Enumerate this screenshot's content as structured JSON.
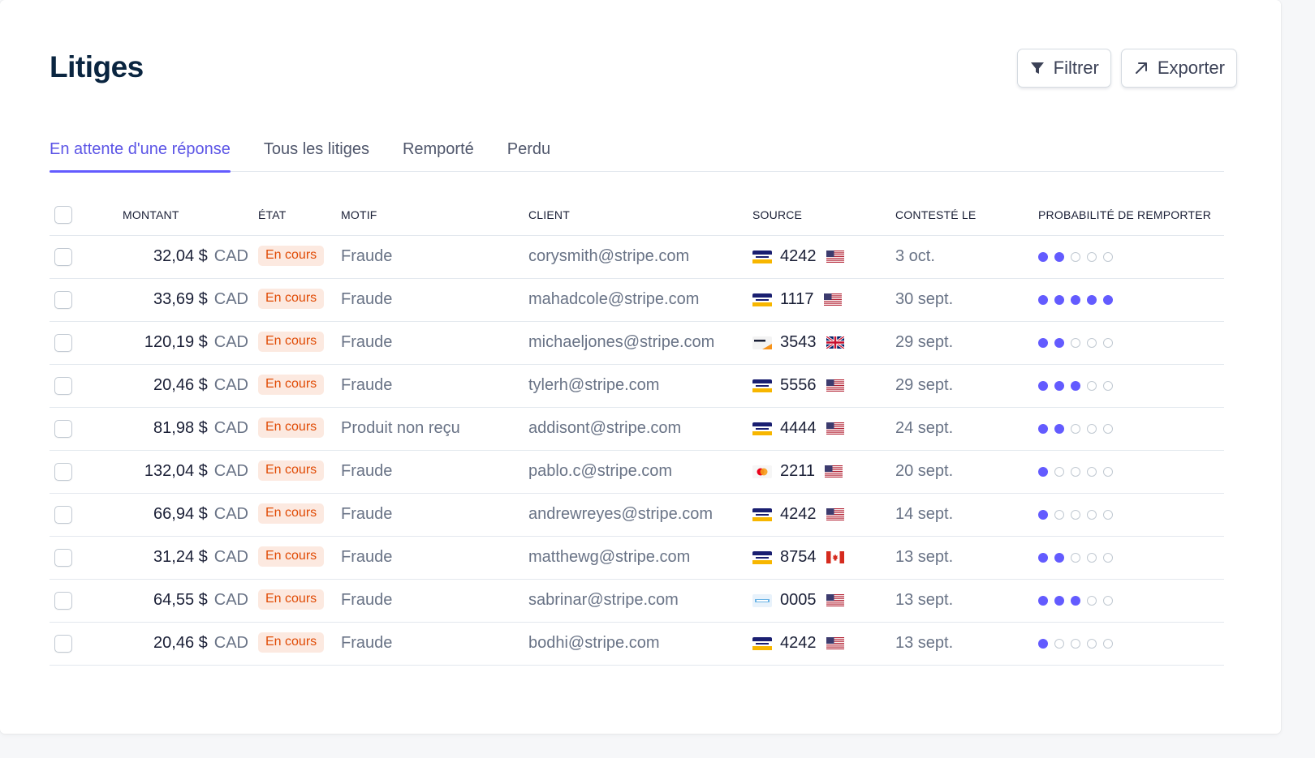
{
  "page": {
    "title": "Litiges"
  },
  "toolbar": {
    "filter_label": "Filtrer",
    "export_label": "Exporter"
  },
  "tabs": [
    {
      "label": "En attente d'une réponse",
      "active": true
    },
    {
      "label": "Tous les litiges",
      "active": false
    },
    {
      "label": "Remporté",
      "active": false
    },
    {
      "label": "Perdu",
      "active": false
    }
  ],
  "table": {
    "headers": {
      "amount": "MONTANT",
      "status": "ÉTAT",
      "reason": "MOTIF",
      "customer": "CLIENT",
      "source": "SOURCE",
      "disputed_on": "CONTESTÉ LE",
      "win_probability": "PROBABILITÉ DE REMPORTER"
    },
    "rows": [
      {
        "amount": "32,04 $",
        "currency": "CAD",
        "status": "En cours",
        "reason": "Fraude",
        "customer": "corysmith@stripe.com",
        "card_brand": "visa-card-icon",
        "last4": "4242",
        "country_flag": "us-flag-icon",
        "date": "3 oct.",
        "probability": 2
      },
      {
        "amount": "33,69 $",
        "currency": "CAD",
        "status": "En cours",
        "reason": "Fraude",
        "customer": "mahadcole@stripe.com",
        "card_brand": "visa-card-icon",
        "last4": "1117",
        "country_flag": "us-flag-icon",
        "date": "30 sept.",
        "probability": 5
      },
      {
        "amount": "120,19 $",
        "currency": "CAD",
        "status": "En cours",
        "reason": "Fraude",
        "customer": "michaeljones@stripe.com",
        "card_brand": "discover-card-icon",
        "last4": "3543",
        "country_flag": "gb-flag-icon",
        "date": "29 sept.",
        "probability": 2
      },
      {
        "amount": "20,46 $",
        "currency": "CAD",
        "status": "En cours",
        "reason": "Fraude",
        "customer": "tylerh@stripe.com",
        "card_brand": "visa-card-icon",
        "last4": "5556",
        "country_flag": "us-flag-icon",
        "date": "29 sept.",
        "probability": 3
      },
      {
        "amount": "81,98 $",
        "currency": "CAD",
        "status": "En cours",
        "reason": "Produit non reçu",
        "customer": "addisont@stripe.com",
        "card_brand": "visa-card-icon",
        "last4": "4444",
        "country_flag": "us-flag-icon",
        "date": "24 sept.",
        "probability": 2
      },
      {
        "amount": "132,04 $",
        "currency": "CAD",
        "status": "En cours",
        "reason": "Fraude",
        "customer": "pablo.c@stripe.com",
        "card_brand": "mastercard-card-icon",
        "last4": "2211",
        "country_flag": "us-flag-icon",
        "date": "20 sept.",
        "probability": 1
      },
      {
        "amount": "66,94 $",
        "currency": "CAD",
        "status": "En cours",
        "reason": "Fraude",
        "customer": "andrewreyes@stripe.com",
        "card_brand": "visa-card-icon",
        "last4": "4242",
        "country_flag": "us-flag-icon",
        "date": "14 sept.",
        "probability": 1
      },
      {
        "amount": "31,24 $",
        "currency": "CAD",
        "status": "En cours",
        "reason": "Fraude",
        "customer": "matthewg@stripe.com",
        "card_brand": "visa-card-icon",
        "last4": "8754",
        "country_flag": "ca-flag-icon",
        "date": "13 sept.",
        "probability": 2
      },
      {
        "amount": "64,55 $",
        "currency": "CAD",
        "status": "En cours",
        "reason": "Fraude",
        "customer": "sabrinar@stripe.com",
        "card_brand": "amex-card-icon",
        "last4": "0005",
        "country_flag": "us-flag-icon",
        "date": "13 sept.",
        "probability": 3
      },
      {
        "amount": "20,46 $",
        "currency": "CAD",
        "status": "En cours",
        "reason": "Fraude",
        "customer": "bodhi@stripe.com",
        "card_brand": "visa-card-icon",
        "last4": "4242",
        "country_flag": "us-flag-icon",
        "date": "13 sept.",
        "probability": 1
      }
    ],
    "probability_max": 5
  },
  "colors": {
    "accent": "#635bff",
    "title": "#0a2540",
    "badge_bg": "#fce9e0",
    "badge_text": "#e04b05"
  }
}
